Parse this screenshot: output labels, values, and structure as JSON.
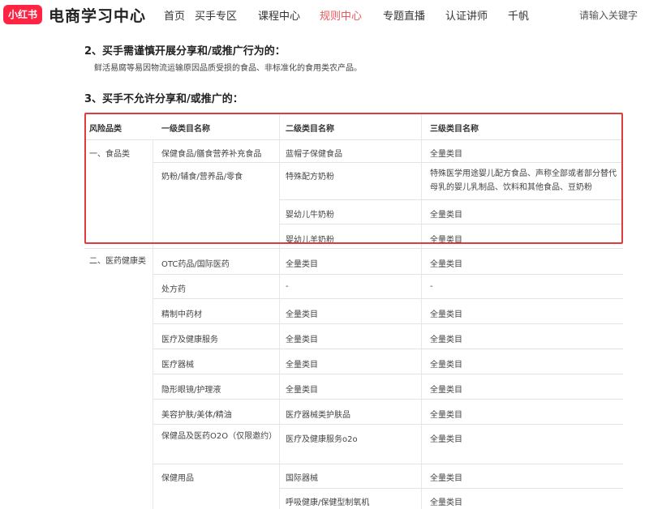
{
  "nav": {
    "logo": "小红书",
    "brand": "电商学习中心",
    "items": [
      "首页",
      "买手专区",
      "课程中心",
      "规则中心",
      "专题直播",
      "认证讲师",
      "千帆"
    ],
    "search_placeholder": "请输入关键字"
  },
  "content": {
    "section2_title": "2、买手需谨慎开展分享和/或推广行为的：",
    "section2_text": "鲜活易腐等易因物流运输原因品质受损的食品、非标准化的食用类农产品。",
    "section3_title": "3、买手不允许分享和/或推广的：",
    "table": {
      "headers": [
        "风险品类",
        "一级类目名称",
        "二级类目名称",
        "三级类目名称"
      ],
      "cells": {
        "r1": [
          "一、食品类",
          "保健食品/膳食营养补充食品",
          "蓝帽子保健食品",
          "全量类目"
        ],
        "r2": [
          "奶粉/辅食/营养品/零食",
          "特殊配方奶粉",
          "特殊医学用途婴儿配方食品、声称全部或者部分替代母乳的婴儿乳制品、饮料和其他食品、豆奶粉"
        ],
        "r3": [
          "婴幼儿牛奶粉",
          "全量类目"
        ],
        "r4": [
          "婴幼儿羊奶粉",
          "全量类目"
        ],
        "r5": [
          "二、医药健康类",
          "OTC药品/国际医药",
          "全量类目",
          "全量类目"
        ],
        "r6": [
          "处方药",
          "-",
          "-"
        ],
        "r7": [
          "精制中药材",
          "全量类目",
          "全量类目"
        ],
        "r8": [
          "医疗及健康服务",
          "全量类目",
          "全量类目"
        ],
        "r9": [
          "医疗器械",
          "全量类目",
          "全量类目"
        ],
        "r10": [
          "隐形眼镜/护理液",
          "全量类目",
          "全量类目"
        ],
        "r11": [
          "美容护肤/美体/精油",
          "医疗器械类护肤品",
          "全量类目"
        ],
        "r12": [
          "保健品及医药O2O（仅限邀约）",
          "医疗及健康服务o2o",
          "全量类目"
        ],
        "r13": [
          "保健用品",
          "国际器械",
          "全量类目"
        ],
        "r14": [
          "呼吸健康/保健型制氧机",
          "全量类目"
        ]
      }
    }
  }
}
